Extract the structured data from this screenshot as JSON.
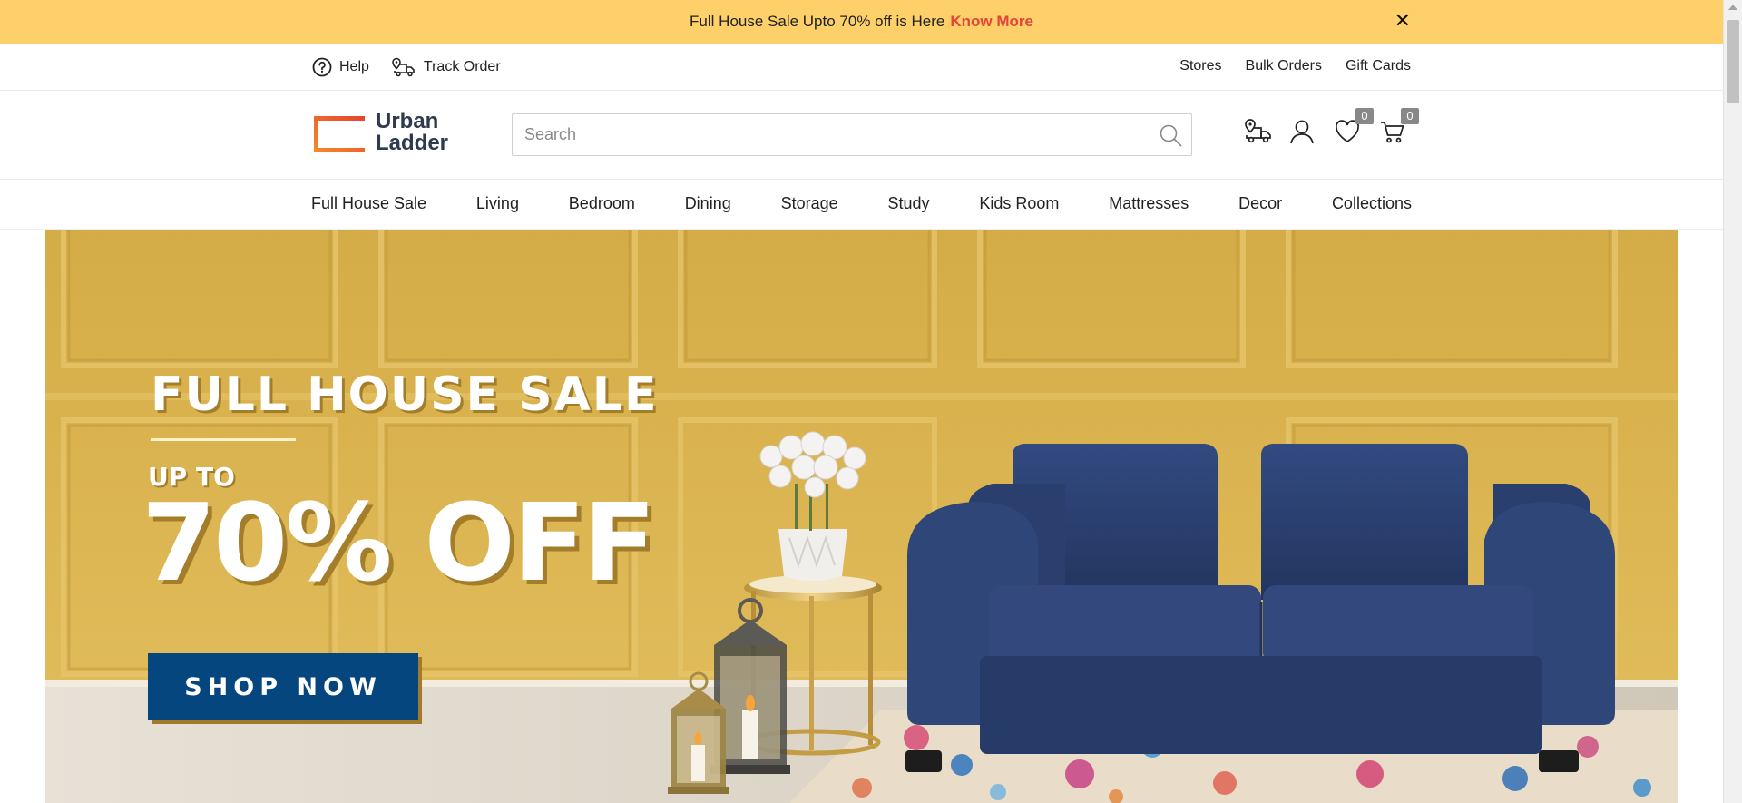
{
  "promo": {
    "text": "Full House Sale Upto 70% off is Here",
    "link": "Know More",
    "close": "✕"
  },
  "utility": {
    "help": "Help",
    "track_order": "Track Order",
    "right_links": [
      "Stores",
      "Bulk Orders",
      "Gift Cards"
    ]
  },
  "header": {
    "logo_line1": "Urban",
    "logo_line2": "Ladder",
    "search_placeholder": "Search",
    "wishlist_count": "0",
    "cart_count": "0"
  },
  "nav": {
    "items": [
      "Full House Sale",
      "Living",
      "Bedroom",
      "Dining",
      "Storage",
      "Study",
      "Kids Room",
      "Mattresses",
      "Decor",
      "Collections"
    ]
  },
  "hero": {
    "title": "FULL HOUSE SALE",
    "upto": "UP TO",
    "discount": "70% OFF",
    "cta": "SHOP NOW"
  },
  "colors": {
    "promo_bg": "#fdd06a",
    "promo_link": "#e2453a",
    "logo_orange": "#f26b2a",
    "cta_bg": "#06467e",
    "sofa": "#2c4272",
    "wall": "#d8b24e"
  },
  "icons": [
    "help-icon",
    "track-order-icon",
    "search-icon",
    "store-locator-icon",
    "profile-icon",
    "wishlist-icon",
    "cart-icon",
    "close-icon"
  ]
}
